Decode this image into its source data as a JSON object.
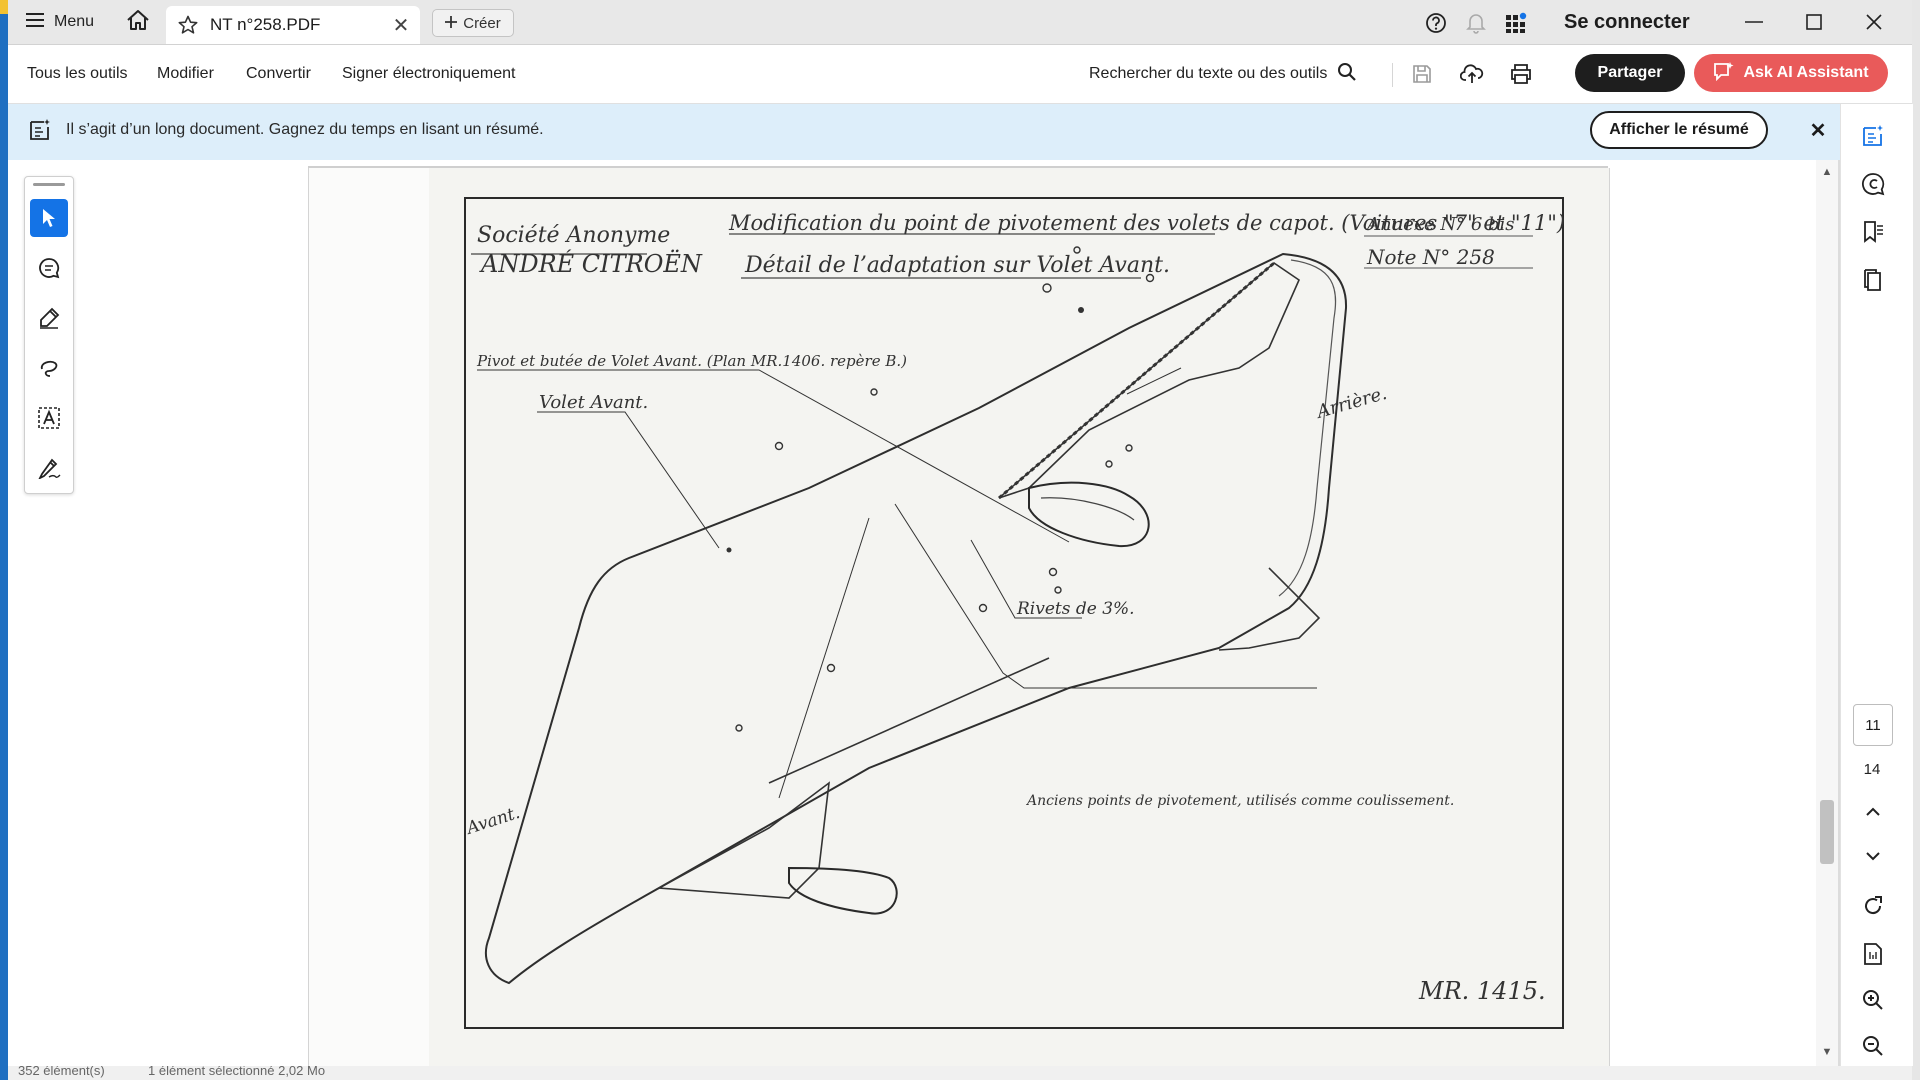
{
  "titlebar": {
    "menu_label": "Menu",
    "tab_title": "NT n°258.PDF",
    "create_label": "Créer",
    "signin_label": "Se connecter"
  },
  "toolbar": {
    "items": [
      "Tous les outils",
      "Modifier",
      "Convertir",
      "Signer électroniquement"
    ],
    "search_label": "Rechercher du texte ou des outils",
    "share_label": "Partager",
    "ai_label": "Ask AI Assistant"
  },
  "banner": {
    "message": "Il s’agit d’un long document. Gagnez du temps en lisant un résumé.",
    "button_label": "Afficher le résumé",
    "close_glyph": "✕"
  },
  "document": {
    "company_line1": "Société Anonyme",
    "company_line2": "ANDRÉ CITROËN",
    "title_line1": "Modification du point de pivotement des volets de capot. (Voitures \"7\" et \"11\")",
    "title_line2": "Détail de l’adaptation sur Volet Avant.",
    "annexe": "Annexe N° 6 bis",
    "note": "Note N° 258",
    "label_pivot": "Pivot et butée de Volet Avant. (Plan MR.1406. repère B.)",
    "label_volet": "Volet Avant.",
    "label_rivets": "Rivets de 3%.",
    "label_arriere": "Arrière.",
    "label_avant": "Avant.",
    "label_anciens": "Anciens points de pivotement, utilisés comme coulissement.",
    "drawing_ref": "MR. 1415."
  },
  "navigation": {
    "current_page": "11",
    "total_pages": "14"
  },
  "statusbar": {
    "items_count": "352 élément(s)",
    "selection": "1 élément sélectionné  2,02 Mo"
  },
  "colors": {
    "accent": "#1473e6",
    "share_button": "#1e1e1e",
    "ai_button": "#e95a5a",
    "banner_bg": "#ddeefa"
  }
}
